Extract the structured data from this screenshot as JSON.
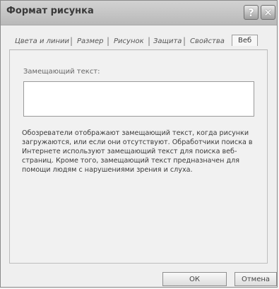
{
  "window": {
    "title": "Формат рисунка",
    "help_glyph": "?",
    "close_glyph": "✕"
  },
  "tabs": [
    {
      "label": "Цвета и линии",
      "active": false
    },
    {
      "label": "Размер",
      "active": false
    },
    {
      "label": "Рисунок",
      "active": false
    },
    {
      "label": "Защита",
      "active": false
    },
    {
      "label": "Свойства",
      "active": false
    },
    {
      "label": "Веб",
      "active": true
    }
  ],
  "web": {
    "alt_text_label": "Замещающий текст:",
    "alt_text_value": "",
    "description": "Обозреватели отображают замещающий текст, когда рисунки загружаются, или если они отсутствуют. Обработчики поиска в Интернете используют замещающий текст для поиска веб-страниц. Кроме того, замещающий текст предназначен для помощи людям с нарушениями зрения и слуха."
  },
  "buttons": {
    "ok": "ОК",
    "cancel": "Отмена"
  }
}
